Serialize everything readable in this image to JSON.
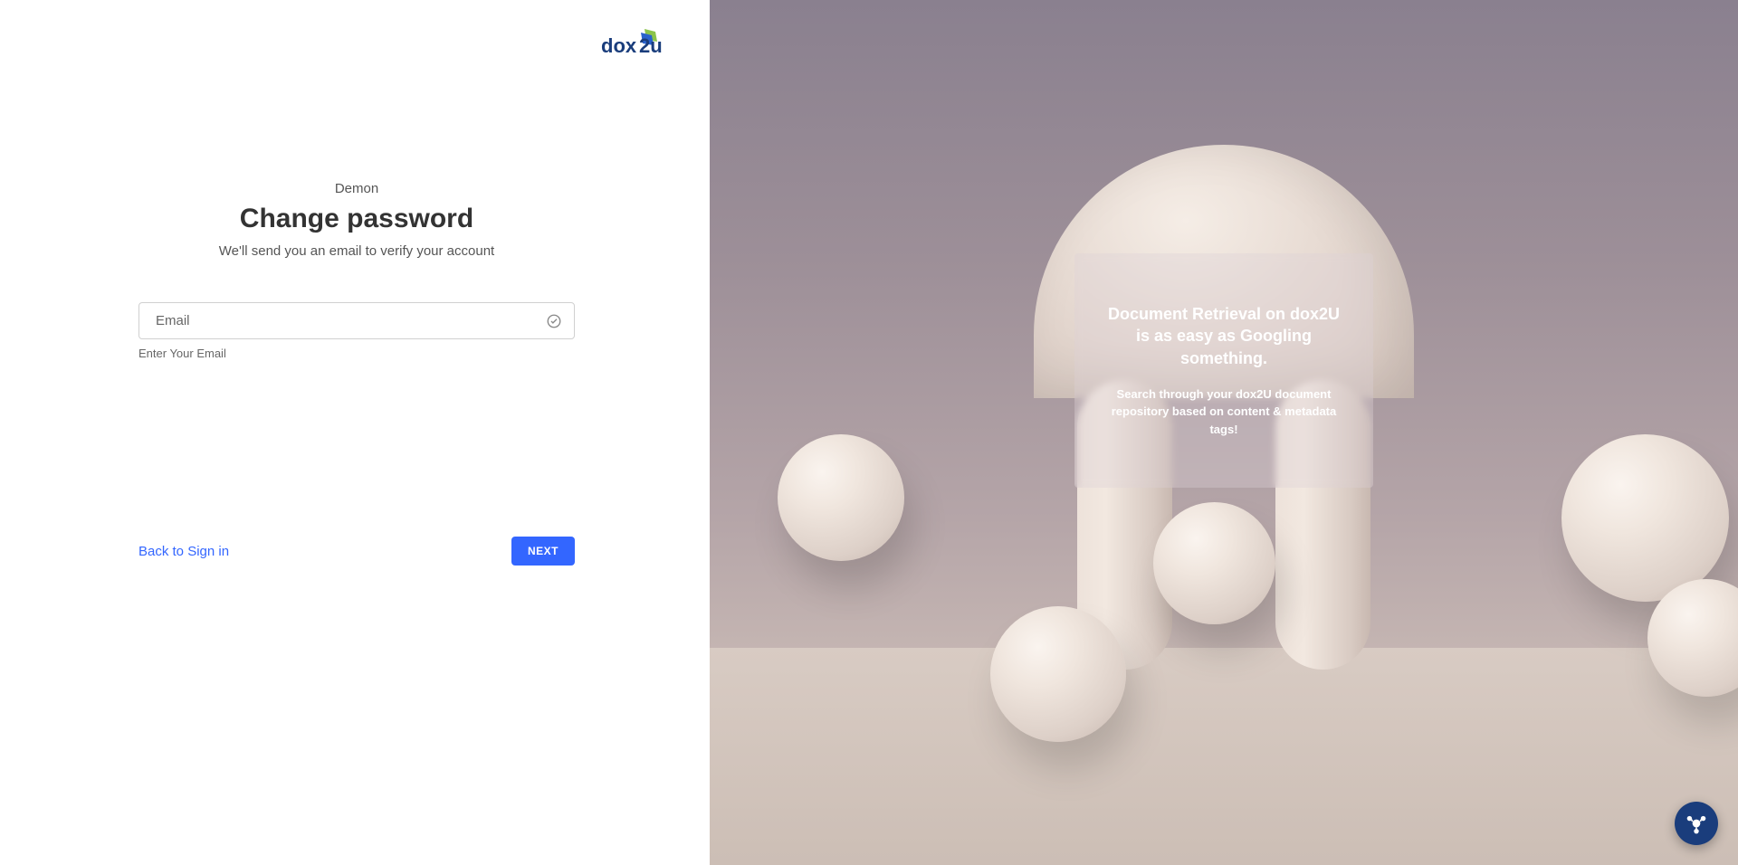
{
  "logo": {
    "brand": "dox2u"
  },
  "form": {
    "subtitle": "Demon",
    "title": "Change password",
    "description": "We'll send you an email to verify your account",
    "email_placeholder": "Email",
    "helper_text": "Enter Your Email",
    "back_link": "Back to Sign in",
    "next_button": "NEXT"
  },
  "info": {
    "title": "Document Retrieval on dox2U is as easy as Googling something.",
    "description": "Search through your dox2U document repository based on content & metadata tags!"
  }
}
